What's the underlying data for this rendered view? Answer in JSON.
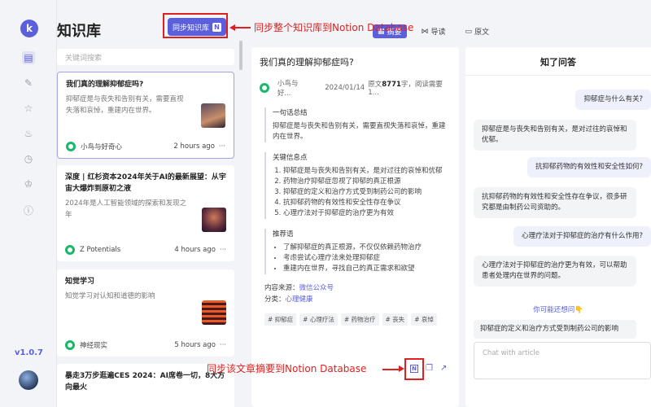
{
  "app": {
    "title": "知识库",
    "version": "v1.0.7",
    "logo_letter": "k"
  },
  "rail": {
    "icons": [
      "book-icon",
      "edit-icon",
      "star-icon",
      "fire-icon",
      "clock-icon",
      "crown-icon",
      "info-icon"
    ]
  },
  "toolbar": {
    "sync_all_label": "同步知识库",
    "search_placeholder": "关键词搜索"
  },
  "cards": [
    {
      "title": "我们真的理解抑郁症吗?",
      "desc": "抑郁症是与丧失和告别有关，需要直视失落和哀悼，重建内在世界。",
      "source": "小鸟与好奇心",
      "time": "2 hours ago"
    },
    {
      "title": "深度 | 红杉资本2024年关于AI的最新展望：从宇宙大爆炸到原初之液",
      "desc": "2024年是人工智能领域的探索和发现之年",
      "source": "Z Potentials",
      "time": "4 hours ago"
    },
    {
      "title": "知觉学习",
      "desc": "知觉学习对认知和道德的影响",
      "source": "神经现实",
      "time": "5 hours ago"
    },
    {
      "title": "暴走3万步逛遍CES 2024：AI席卷一切，8大方向最火"
    }
  ],
  "tabs": [
    {
      "label": "摘要"
    },
    {
      "label": "导读"
    },
    {
      "label": "原文"
    }
  ],
  "article": {
    "title": "我们真的理解抑郁症吗?",
    "source": "小鸟与好...",
    "date": "2024/01/14",
    "orig_prefix": "原文",
    "word_count": "8771",
    "word_suffix": "字，阅读需要1...",
    "summary_heading": "一句话总结",
    "summary": "抑郁症是与丧失和告别有关，需要直视失落和哀悼，重建内在世界。",
    "key_heading": "关键信息点",
    "key_points": [
      "抑郁症是与丧失和告别有关，是对过往的哀悼和优郁",
      "药物治疗抑郁症忽视了抑郁的真正根源",
      "抑郁症的定义和治疗方式受到制药公司的影响",
      "抗抑郁药物的有效性和安全性存在争议",
      "心理疗法对于抑郁症的治疗更为有效"
    ],
    "rec_heading": "推荐语",
    "recommendations": [
      "了解抑郁症的真正根源，不仅仅依赖药物治疗",
      "考虑尝试心理疗法来处理抑郁症",
      "重建内在世界，寻找自己的真正需求和欲望"
    ],
    "source_label": "内容来源：",
    "source_value": "微信公众号",
    "category_label": "分类：",
    "category_value": "心理健康",
    "tags": [
      "# 抑郁症",
      "# 心理疗法",
      "# 药物治疗",
      "# 丧失",
      "# 哀悼"
    ]
  },
  "chat": {
    "title": "知了问答",
    "messages": [
      {
        "role": "q",
        "text": "抑郁症与什么有关?"
      },
      {
        "role": "a",
        "text": "抑郁症是与丧失和告别有关，是对过往的哀悼和优郁。"
      },
      {
        "role": "q",
        "text": "抗抑郁药物的有效性和安全性如何?"
      },
      {
        "role": "a",
        "text": "抗抑郁药物的有效性和安全性存在争议，很多研究都是由制药公司资助的。"
      },
      {
        "role": "q",
        "text": "心理疗法对于抑郁症的治疗有什么作用?"
      },
      {
        "role": "a",
        "text": "心理疗法对于抑郁症的治疗更为有效，可以帮助患者处理内在世界的问题。"
      }
    ],
    "maybe_label": "你可能还想问👇",
    "suggestion": "抑郁症的定义和治疗方式受到制药公司的影响",
    "input_placeholder": "Chat with article"
  },
  "annotations": {
    "top": "同步整个知识库到Notion Database",
    "bottom": "同步该文章摘要到Notion Database"
  },
  "colors": {
    "accent": "#5b5fdc",
    "annotation": "#e02020",
    "source_green": "#17b86a"
  }
}
